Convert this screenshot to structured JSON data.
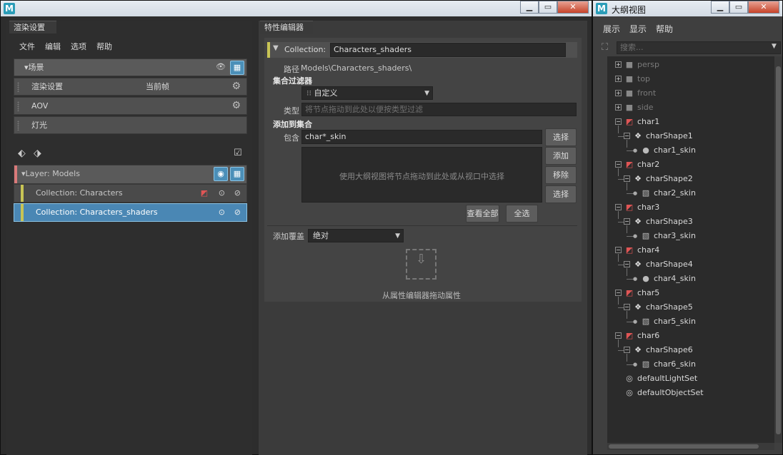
{
  "render_window": {
    "title": "",
    "window_buttons": {
      "minimize": "▁",
      "restore": "▭",
      "close": "✕"
    },
    "panel_tab": "渲染设置",
    "menu": [
      "文件",
      "编辑",
      "选项",
      "帮助"
    ],
    "scene_row": "▾场景",
    "rows": [
      {
        "label": "渲染设置",
        "extra": "当前帧"
      },
      {
        "label": "AOV",
        "extra": ""
      },
      {
        "label": "灯光",
        "extra": ""
      }
    ],
    "layer_label": "▾Layer:   Models",
    "collections": [
      {
        "label": "Collection:   Characters",
        "selected": false
      },
      {
        "label": "Collection:   Characters_shaders",
        "selected": true
      }
    ]
  },
  "attribute_editor": {
    "panel_tab": "特性编辑器",
    "collection_label": "Collection:",
    "collection_name": "Characters_shaders",
    "path_label": "路径",
    "path_value": "Models\\Characters_shaders\\",
    "filter_heading": "集合过滤器",
    "filter_value": "自定义",
    "type_label": "类型",
    "type_placeholder": "将节点拖动到此处以便按类型过滤",
    "add_heading": "添加到集合",
    "include_label": "包含",
    "include_value": "char*_skin",
    "list_placeholder": "使用大纲视图将节点拖动到此处或从视口中选择",
    "buttons": {
      "select1": "选择",
      "add": "添加",
      "remove": "移除",
      "select2": "选择",
      "view_all": "查看全部",
      "select_all": "全选"
    },
    "override_label": "添加覆盖",
    "override_value": "绝对",
    "drag_hint": "从属性编辑器拖动属性"
  },
  "outliner": {
    "title": "大纲视图",
    "menu": [
      "展示",
      "显示",
      "帮助"
    ],
    "search_placeholder": "搜索...",
    "cameras": [
      "persp",
      "top",
      "front",
      "side"
    ],
    "chars": [
      {
        "name": "char1",
        "shape": "charShape1",
        "skin": "char1_skin",
        "skin_icon": "sphere"
      },
      {
        "name": "char2",
        "shape": "charShape2",
        "skin": "char2_skin",
        "skin_icon": "cube"
      },
      {
        "name": "char3",
        "shape": "charShape3",
        "skin": "char3_skin",
        "skin_icon": "cube"
      },
      {
        "name": "char4",
        "shape": "charShape4",
        "skin": "char4_skin",
        "skin_icon": "sphere"
      },
      {
        "name": "char5",
        "shape": "charShape5",
        "skin": "char5_skin",
        "skin_icon": "cube"
      },
      {
        "name": "char6",
        "shape": "charShape6",
        "skin": "char6_skin",
        "skin_icon": "cube"
      }
    ],
    "sets": [
      "defaultLightSet",
      "defaultObjectSet"
    ]
  },
  "colors": {
    "accent_blue": "#4b8fb8",
    "layer_red": "#d97a7a",
    "collection_yellow": "#c8c455",
    "selected_row": "#4a87b4"
  }
}
